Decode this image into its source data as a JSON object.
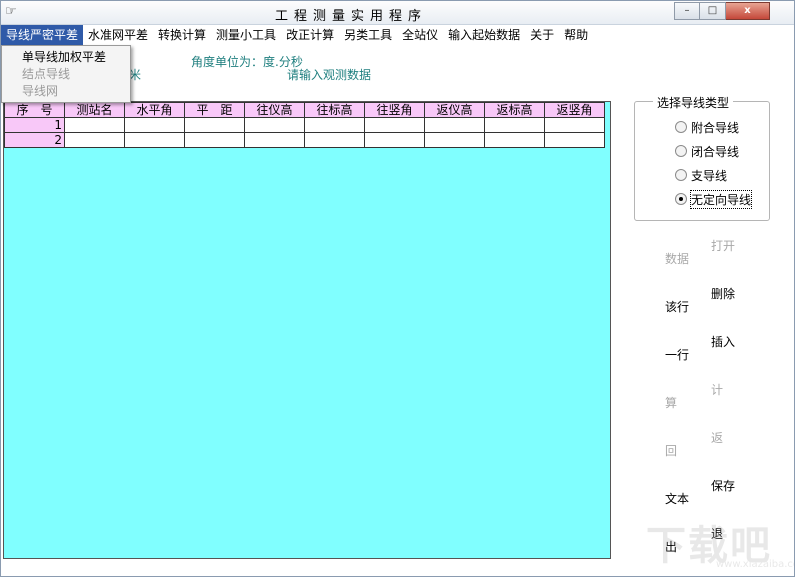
{
  "window": {
    "icon": "☞",
    "title": "工程测量实用程序",
    "minimize": "–",
    "maximize": "□",
    "close": "x"
  },
  "menu": [
    {
      "label": "导线严密平差"
    },
    {
      "label": "水准网平差"
    },
    {
      "label": "转换计算"
    },
    {
      "label": "测量小工具"
    },
    {
      "label": "改正计算"
    },
    {
      "label": "另类工具"
    },
    {
      "label": "全站仪"
    },
    {
      "label": "输入起始数据"
    },
    {
      "label": "关于"
    },
    {
      "label": "帮助"
    }
  ],
  "dropdown": [
    {
      "label": "单导线加权平差",
      "enabled": true
    },
    {
      "label": "结点导线",
      "enabled": false
    },
    {
      "label": "导线网",
      "enabled": false
    }
  ],
  "info": {
    "unit": "米",
    "angle": "角度单位为：度.分秒",
    "prompt": "请输入观测数据"
  },
  "grid": {
    "headers": [
      "序　号",
      "测站名",
      "水平角",
      "平　距",
      "往仪高",
      "往标高",
      "往竖角",
      "返仪高",
      "返标高",
      "返竖角"
    ],
    "rows": [
      "1",
      "2"
    ]
  },
  "traverse_type": {
    "title": "选择导线类型",
    "options": [
      {
        "label": "附合导线",
        "checked": false
      },
      {
        "label": "闭合导线",
        "checked": false
      },
      {
        "label": "支导线",
        "checked": false
      },
      {
        "label": "无定向导线",
        "checked": true
      }
    ]
  },
  "side": {
    "open": "打开",
    "data": "数据",
    "delete": "删除",
    "this_row": "该行",
    "insert": "插入",
    "one_row": "一行",
    "calc": "计",
    "suan": "算",
    "return": "返",
    "hui": "回",
    "save": "保存",
    "text": "文本",
    "exit": "退",
    "chu": "出"
  },
  "watermark": {
    "text": "下载吧",
    "url": "www.xiazaiba.com"
  }
}
